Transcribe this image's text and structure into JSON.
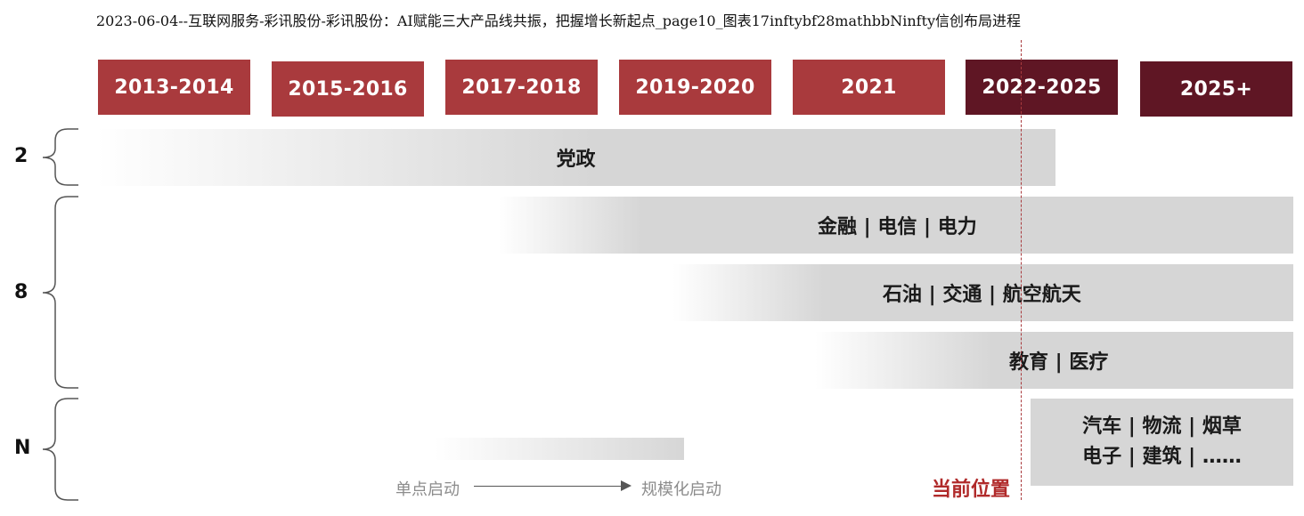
{
  "caption": "2023-06-04--互联网服务-彩讯股份-彩讯股份：AI赋能三大产品线共振，把握增长新起点_page10_图表17inftybf28mathbbNinfty信创布局进程",
  "timeline": [
    "2013-2014",
    "2015-2016",
    "2017-2018",
    "2019-2020",
    "2021",
    "2022-2025",
    "2025+"
  ],
  "tiers": [
    "2",
    "8",
    "N"
  ],
  "bands": {
    "party": "党政",
    "finance": "金融 | 电信 | 电力",
    "oil": "石油 | 交通 | 航空航天",
    "edu": "教育 | 医疗",
    "more_line1": "汽车 | 物流 | 烟草",
    "more_line2": "电子 | 建筑 | ……"
  },
  "legend": {
    "start": "单点启动",
    "scale": "规模化启动"
  },
  "current_position": "当前位置",
  "colors": {
    "past_year": "#a93a3d",
    "future_year": "#5f1624",
    "band": "#d6d6d6",
    "current_marker": "#b02a2a"
  }
}
